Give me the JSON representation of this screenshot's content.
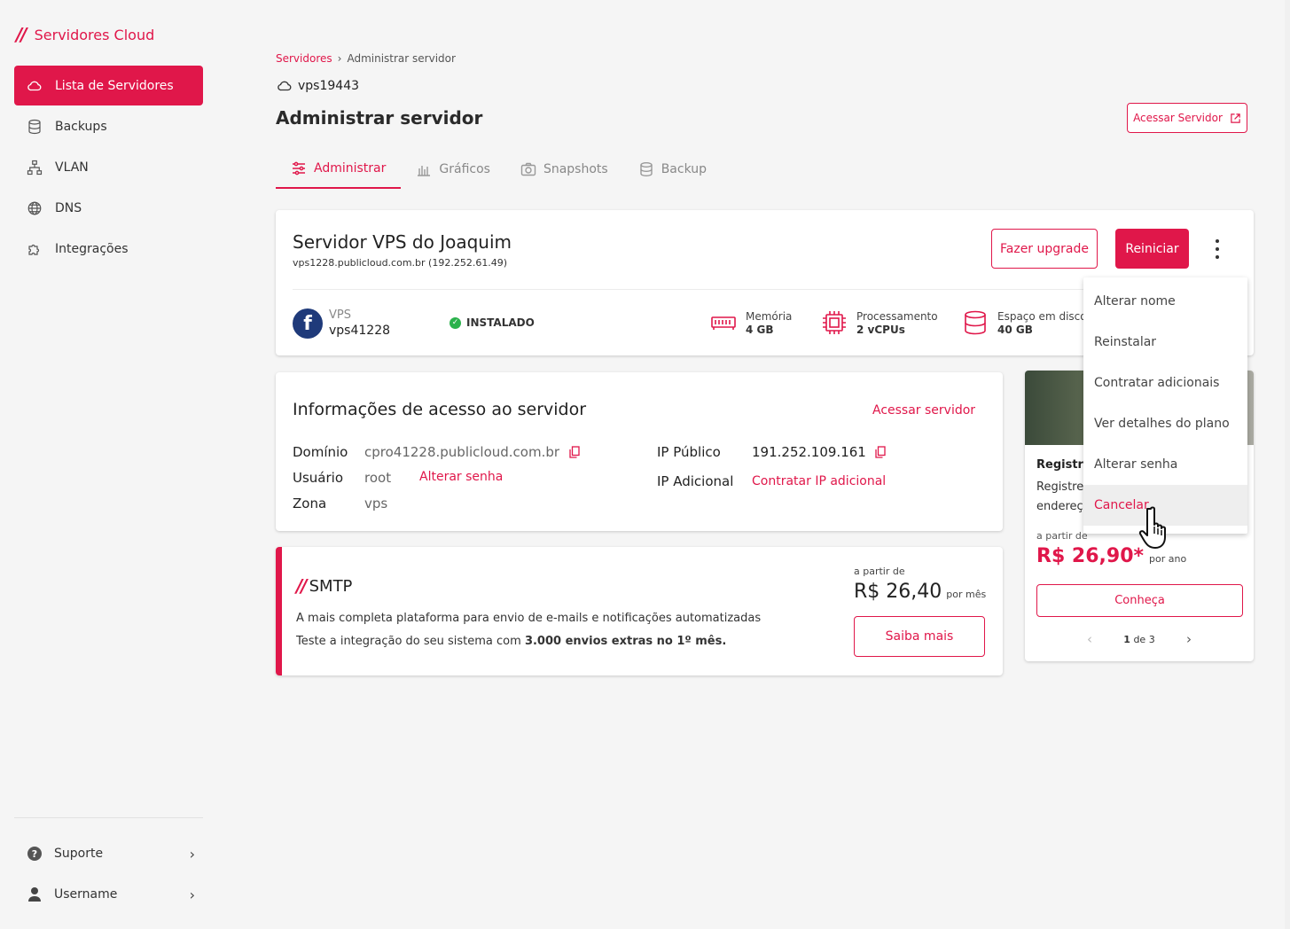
{
  "app": {
    "logo_mark": "//",
    "name": "Servidores Cloud"
  },
  "sidebar": {
    "items": [
      {
        "label": "Lista de Servidores",
        "icon": "cloud-icon",
        "active": true
      },
      {
        "label": "Backups",
        "icon": "database-icon"
      },
      {
        "label": "VLAN",
        "icon": "network-icon"
      },
      {
        "label": "DNS",
        "icon": "globe-icon"
      },
      {
        "label": "Integrações",
        "icon": "puzzle-icon"
      }
    ],
    "bottom": [
      {
        "label": "Suporte",
        "icon": "help-icon"
      },
      {
        "label": "Username",
        "icon": "user-icon"
      }
    ]
  },
  "breadcrumb": {
    "root": "Servidores",
    "separator": "›",
    "current": "Administrar servidor"
  },
  "header": {
    "server_id": "vps19443",
    "title": "Administrar servidor",
    "access_button": "Acessar Servidor"
  },
  "tabs": [
    {
      "label": "Administrar",
      "icon": "sliders-icon",
      "active": true
    },
    {
      "label": "Gráficos",
      "icon": "bar-chart-icon"
    },
    {
      "label": "Snapshots",
      "icon": "camera-icon"
    },
    {
      "label": "Backup",
      "icon": "database-icon"
    }
  ],
  "server": {
    "name": "Servidor VPS do Joaquim",
    "host": "vps1228.publicloud.com.br (192.252.61.49)",
    "upgrade_label": "Fazer upgrade",
    "restart_label": "Reiniciar",
    "os_glyph": "f",
    "type": "VPS",
    "id": "vps41228",
    "status": "INSTALADO",
    "specs": {
      "memory_label": "Memória",
      "memory_value": "4 GB",
      "cpu_label": "Processamento",
      "cpu_value": "2 vCPUs",
      "disk_label": "Espaço em disco",
      "disk_value": "40 GB"
    }
  },
  "menu": {
    "items": [
      "Alterar nome",
      "Reinstalar",
      "Contratar adicionais",
      "Ver detalhes do plano",
      "Alterar senha",
      "Cancelar"
    ]
  },
  "access_info": {
    "title": "Informações de acesso ao servidor",
    "link": "Acessar servidor",
    "domain_label": "Domínio",
    "domain_value": "cpro41228.publicloud.com.br",
    "user_label": "Usuário",
    "user_value": "root",
    "change_password": "Alterar senha",
    "zone_label": "Zona",
    "zone_value": "vps",
    "public_ip_label": "IP Público",
    "public_ip_value": "191.252.109.161",
    "extra_ip_label": "IP Adicional",
    "extra_ip_link": "Contratar IP adicional"
  },
  "smtp": {
    "logo_mark": "//",
    "name": "SMTP",
    "desc": "A mais completa plataforma para envio de e-mails e notificações automatizadas",
    "desc2_prefix": "Teste a integração do seu sistema com ",
    "desc2_bold": "3.000 envios extras no 1º mês.",
    "from": "a partir de",
    "price": "R$ 26,40",
    "period": "por mês",
    "button": "Saiba mais"
  },
  "promo": {
    "title": "Registro",
    "text1": "Registre",
    "text2": "endereç",
    "from": "a partir de",
    "price": "R$ 26,90*",
    "period": "por ano",
    "button": "Conheça",
    "pager_current": "1",
    "pager_text": "de 3"
  },
  "colors": {
    "accent": "#e0174a",
    "success": "#2bb24c"
  }
}
